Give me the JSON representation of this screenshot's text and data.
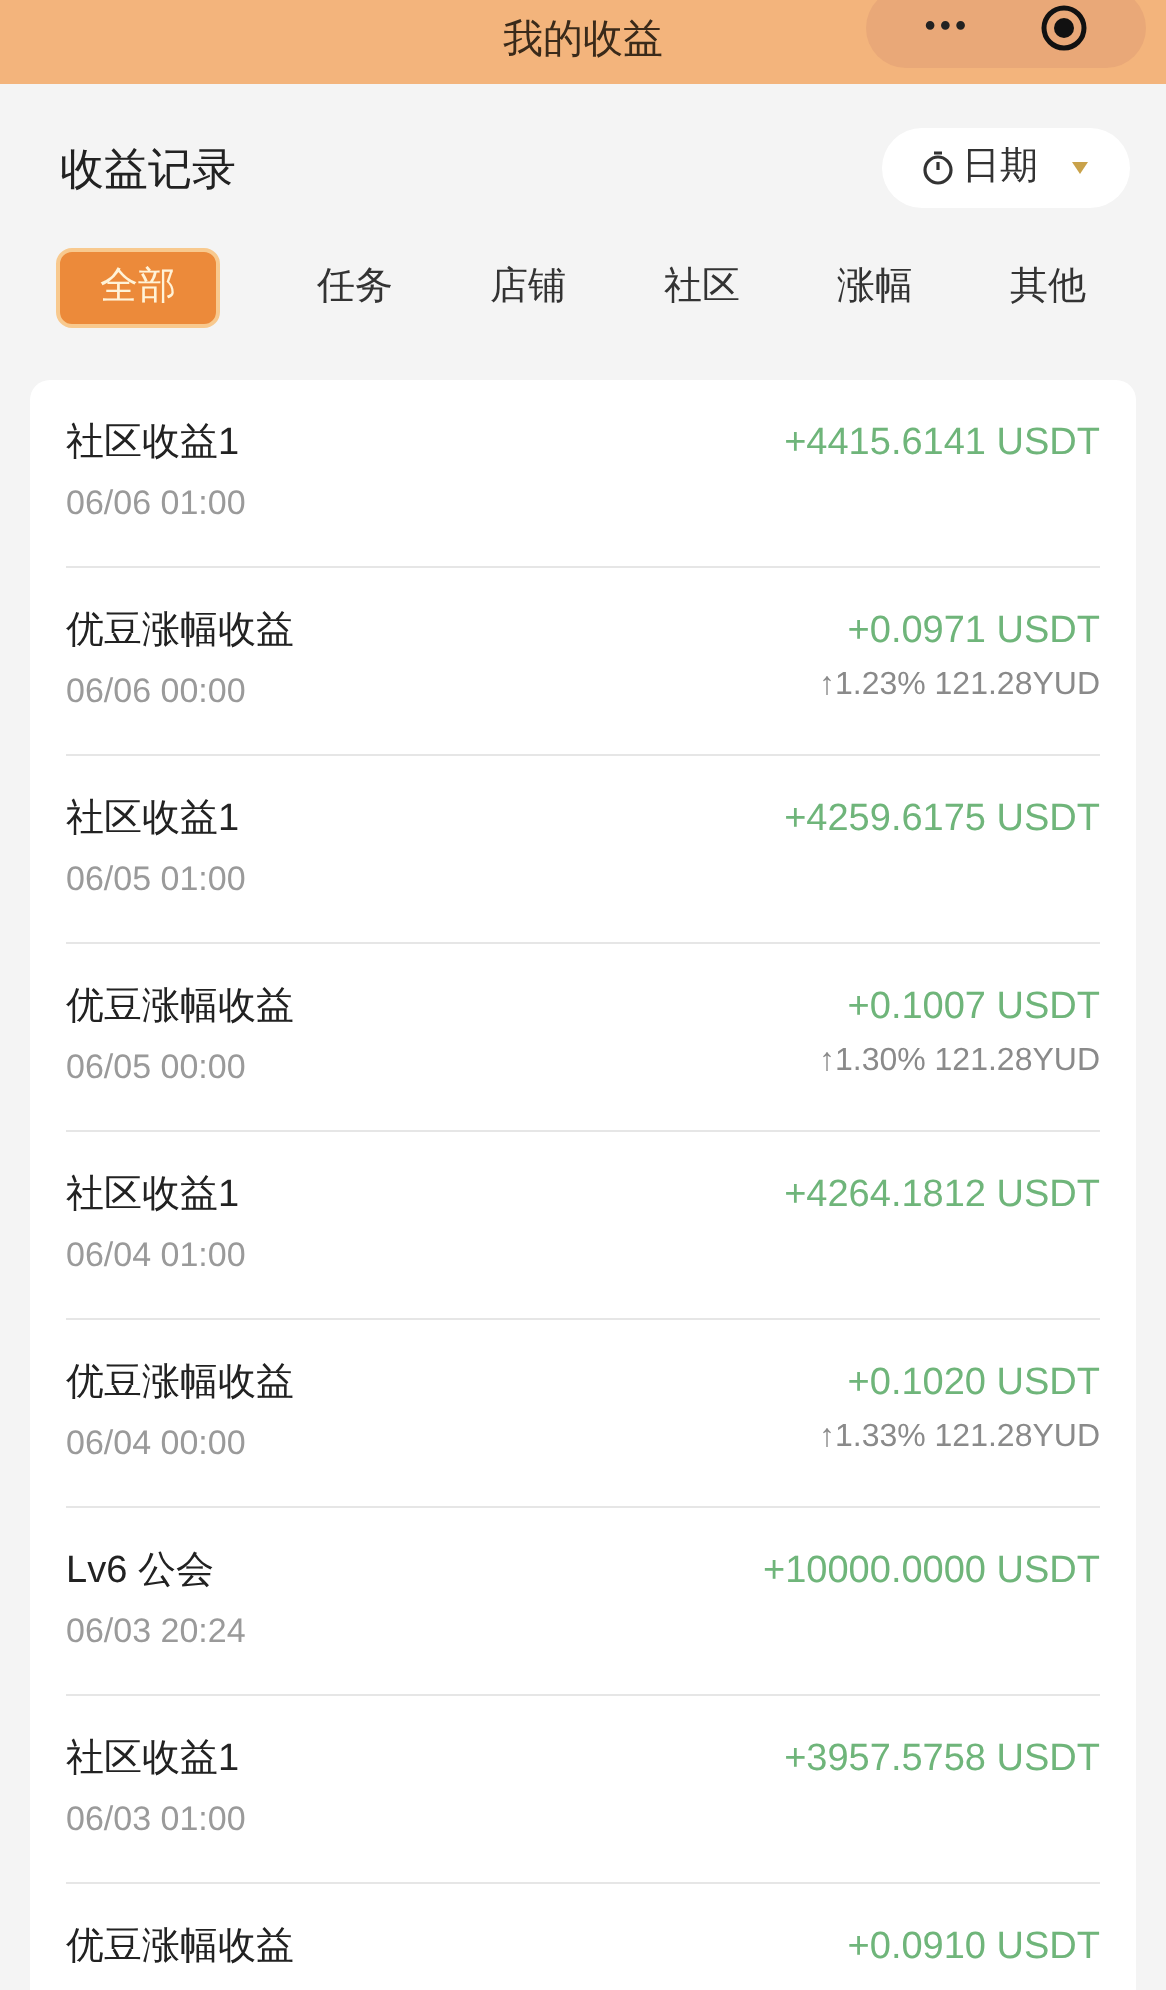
{
  "header": {
    "title": "我的收益",
    "more": "•••"
  },
  "section": {
    "title": "收益记录",
    "date_filter": "日期"
  },
  "tabs": [
    {
      "label": "全部",
      "selected": true
    },
    {
      "label": "任务",
      "selected": false
    },
    {
      "label": "店铺",
      "selected": false
    },
    {
      "label": "社区",
      "selected": false
    },
    {
      "label": "涨幅",
      "selected": false
    },
    {
      "label": "其他",
      "selected": false
    }
  ],
  "records": [
    {
      "title": "社区收益1",
      "time": "06/06 01:00",
      "amount": "+4415.6141 USDT"
    },
    {
      "title": "优豆涨幅收益",
      "time": "06/06 00:00",
      "amount": "+0.0971 USDT",
      "detail": "↑1.23% 121.28YUD"
    },
    {
      "title": "社区收益1",
      "time": "06/05 01:00",
      "amount": "+4259.6175 USDT"
    },
    {
      "title": "优豆涨幅收益",
      "time": "06/05 00:00",
      "amount": "+0.1007 USDT",
      "detail": "↑1.30% 121.28YUD"
    },
    {
      "title": "社区收益1",
      "time": "06/04 01:00",
      "amount": "+4264.1812 USDT"
    },
    {
      "title": "优豆涨幅收益",
      "time": "06/04 00:00",
      "amount": "+0.1020 USDT",
      "detail": "↑1.33% 121.28YUD"
    },
    {
      "title": "Lv6 公会",
      "time": "06/03 20:24",
      "amount": "+10000.0000 USDT"
    },
    {
      "title": "社区收益1",
      "time": "06/03 01:00",
      "amount": "+3957.5758 USDT"
    },
    {
      "title": "优豆涨幅收益",
      "amount": "+0.0910 USDT"
    }
  ]
}
